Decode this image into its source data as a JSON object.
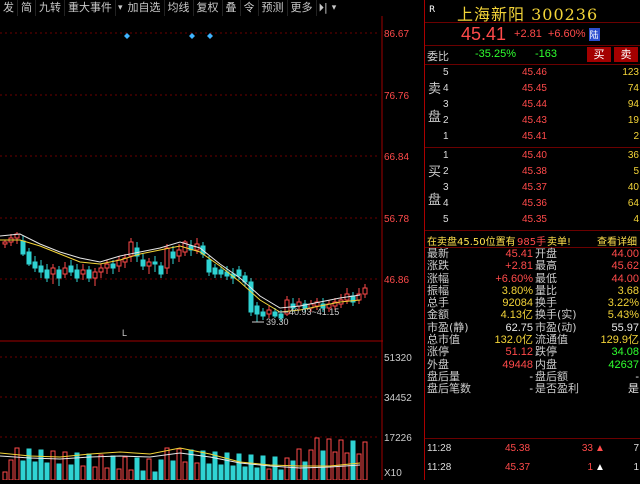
{
  "toolbar": {
    "items": [
      "发",
      "简",
      "九转",
      "重大事件",
      "加自选",
      "均线",
      "复权",
      "叠",
      "令",
      "预测",
      "更多"
    ],
    "dropdown_icon": "chevron-down-icon",
    "bell_icon": "bell-icon",
    "expand_icon": "expand-arrow-icon"
  },
  "axis": {
    "prices": [
      "86.67",
      "76.76",
      "66.84",
      "56.78",
      "46.86"
    ],
    "volumes": [
      "51320",
      "34452",
      "17226"
    ],
    "vol_unit": "X10",
    "low_label": "39.30",
    "range_label": "40.93~41.15",
    "marker": "L"
  },
  "quote": {
    "tag": "R",
    "name": "上海新阳 300236",
    "price": "45.41",
    "change": "+2.81",
    "change_pct": "+6.60%",
    "badge": "陆"
  },
  "weibi": {
    "label": "委比",
    "ratio": "-35.25%",
    "diff": "-163",
    "buy_btn": "买",
    "sell_btn": "卖"
  },
  "asks": [
    {
      "level": "5",
      "price": "45.46",
      "vol": "123"
    },
    {
      "level": "4",
      "price": "45.45",
      "vol": "74"
    },
    {
      "level": "3",
      "price": "45.44",
      "vol": "94"
    },
    {
      "level": "2",
      "price": "45.43",
      "vol": "19"
    },
    {
      "level": "1",
      "price": "45.41",
      "vol": "2"
    }
  ],
  "ask_label": [
    "卖",
    "盘"
  ],
  "bids": [
    {
      "level": "1",
      "price": "45.40",
      "vol": "36"
    },
    {
      "level": "2",
      "price": "45.38",
      "vol": "5"
    },
    {
      "level": "3",
      "price": "45.37",
      "vol": "40"
    },
    {
      "level": "4",
      "price": "45.36",
      "vol": "64"
    },
    {
      "level": "5",
      "price": "45.35",
      "vol": "4"
    }
  ],
  "bid_label": [
    "买",
    "盘"
  ],
  "trade_info": {
    "text": "在卖盘45.50位置有",
    "amount": "985手",
    "action": "卖单!",
    "link": "查看详细"
  },
  "stats": [
    {
      "l1": "最新",
      "v1": "45.41",
      "c1": "red",
      "l2": "开盘",
      "v2": "44.00",
      "c2": "red"
    },
    {
      "l1": "涨跌",
      "v1": "+2.81",
      "c1": "red",
      "l2": "最高",
      "v2": "45.62",
      "c2": "red"
    },
    {
      "l1": "涨幅",
      "v1": "+6.60%",
      "c1": "red",
      "l2": "最低",
      "v2": "44.00",
      "c2": "red"
    },
    {
      "l1": "振幅",
      "v1": "3.80%",
      "c1": "yellow",
      "l2": "量比",
      "v2": "3.68",
      "c2": "yellow"
    },
    {
      "l1": "总手",
      "v1": "92084",
      "c1": "yellow",
      "l2": "换手",
      "v2": "3.22%",
      "c2": "yellow"
    },
    {
      "l1": "金额",
      "v1": "4.13亿",
      "c1": "yellow",
      "l2": "换手(实)",
      "v2": "5.43%",
      "c2": "yellow"
    },
    {
      "l1": "市盈(静)",
      "v1": "62.75",
      "c1": "white",
      "l2": "市盈(动)",
      "v2": "55.97",
      "c2": "white"
    },
    {
      "l1": "总市值",
      "v1": "132.0亿",
      "c1": "yellow",
      "l2": "流通值",
      "v2": "129.9亿",
      "c2": "yellow"
    },
    {
      "l1": "涨停",
      "v1": "51.12",
      "c1": "red",
      "l2": "跌停",
      "v2": "34.08",
      "c2": "green"
    },
    {
      "l1": "外盘",
      "v1": "49448",
      "c1": "red",
      "l2": "内盘",
      "v2": "42637",
      "c2": "green"
    },
    {
      "l1": "盘后量",
      "v1": "-",
      "c1": "white",
      "l2": "盘后额",
      "v2": "-",
      "c2": "white"
    },
    {
      "l1": "盘后笔数",
      "v1": "-",
      "c1": "white",
      "l2": "是否盈利",
      "v2": "是",
      "c2": "white"
    }
  ],
  "ticks": [
    {
      "time": "11:28",
      "price": "45.38",
      "vol": "33",
      "dir": "up",
      "count": "7"
    },
    {
      "time": "11:28",
      "price": "45.37",
      "vol": "1",
      "dir": "up",
      "count": "1"
    }
  ],
  "colors": {
    "up": "#ff4a4a",
    "down": "#2fff2f",
    "accent": "#f3d438",
    "frame": "#a00000",
    "background": "#000000"
  }
}
